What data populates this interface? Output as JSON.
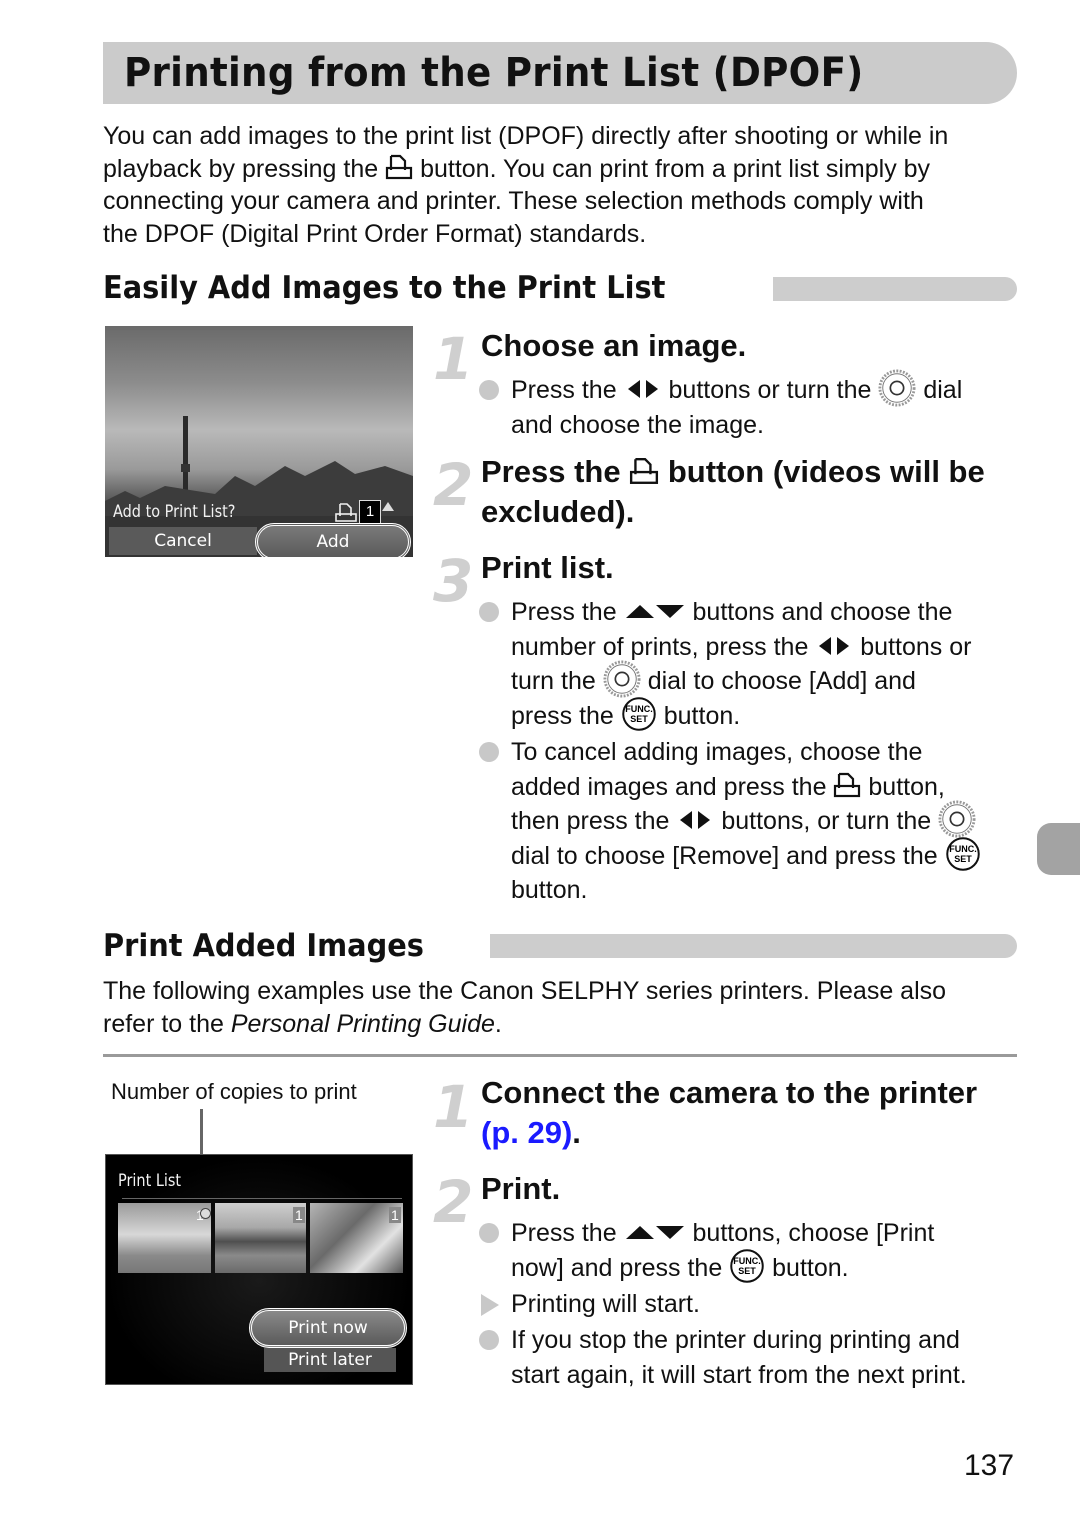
{
  "page": {
    "title": "Printing from the Print List (DPOF)",
    "intro": {
      "l1": "You can add images to the print list (DPOF) directly after shooting or while in",
      "l2a": "playback by pressing the",
      "l2b": "button. You can print from a print list simply by",
      "l3": "connecting your camera and printer. These selection methods comply with",
      "l4": "the DPOF (Digital Print Order Format) standards."
    },
    "page_number": "137"
  },
  "section1": {
    "heading": "Easily Add Images to the Print List",
    "screen": {
      "prompt": "Add to Print List?",
      "copies": "1",
      "cancel_label": "Cancel",
      "add_label": "Add"
    },
    "steps": [
      {
        "number": "1",
        "title": "Choose an image.",
        "bullet1": {
          "a": "Press the",
          "b": "buttons or turn the",
          "c": "dial",
          "l2": "and choose the image."
        }
      },
      {
        "number": "2",
        "title_a": "Press the",
        "title_b": "button (videos will be",
        "title_l2": "excluded)."
      },
      {
        "number": "3",
        "title": "Print list.",
        "bullet1": {
          "l1a": "Press the",
          "l1b": "buttons and choose the",
          "l2a": "number of prints, press the",
          "l2b": "buttons or",
          "l3a": "turn the",
          "l3b": "dial to choose [Add] and",
          "l4a": "press the",
          "l4b": "button."
        },
        "bullet2": {
          "l1": "To cancel adding images, choose the",
          "l2a": "added images and press the",
          "l2b": "button,",
          "l3a": "then press the",
          "l3b": "buttons, or turn the",
          "l4a": "dial to choose [Remove] and press the",
          "l5": "button."
        }
      }
    ]
  },
  "section2": {
    "heading": "Print Added Images",
    "desc_l1": "The following examples use the Canon SELPHY series printers. Please also",
    "desc_l2a": "refer to the",
    "desc_l2_italic": "Personal Printing Guide",
    "desc_l2b": ".",
    "callout": "Number of copies to print",
    "screen": {
      "title": "Print List",
      "thumb_counts": [
        "1",
        "1",
        "1"
      ],
      "print_now_label": "Print now",
      "print_later_label": "Print later"
    },
    "steps": [
      {
        "number": "1",
        "title": "Connect the camera to the printer",
        "link": "(p. 29)",
        "after_link": "."
      },
      {
        "number": "2",
        "title": "Print.",
        "bullet1": {
          "l1a": "Press the",
          "l1b": "buttons, choose [Print",
          "l2a": "now] and press the",
          "l2b": "button."
        },
        "result": "Printing will start.",
        "bullet2": {
          "l1": "If you stop the printer during printing and",
          "l2": "start again, it will start from the next print."
        }
      }
    ]
  },
  "colors": {
    "title_bar": "#cbcbcb",
    "step_number": "#cfcfcf",
    "link": "#1a1aff",
    "side_tab": "#a3a3a3"
  }
}
